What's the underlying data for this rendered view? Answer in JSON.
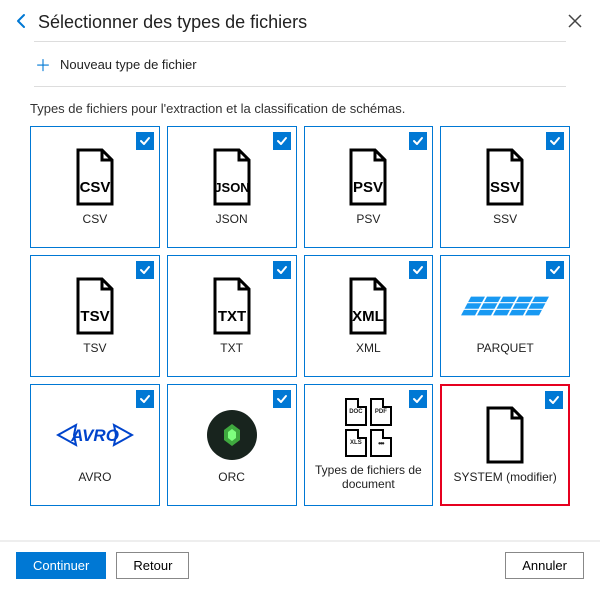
{
  "header": {
    "title": "Sélectionner des types de fichiers"
  },
  "newType": {
    "label": "Nouveau type de fichier"
  },
  "subtitle": "Types de fichiers pour l'extraction et la classification de schémas.",
  "tiles": [
    {
      "label": "CSV",
      "icon": "doc",
      "tag": "CSV",
      "highlight": false
    },
    {
      "label": "JSON",
      "icon": "doc",
      "tag": "JSON",
      "highlight": false
    },
    {
      "label": "PSV",
      "icon": "doc",
      "tag": "PSV",
      "highlight": false
    },
    {
      "label": "SSV",
      "icon": "doc",
      "tag": "SSV",
      "highlight": false
    },
    {
      "label": "TSV",
      "icon": "doc",
      "tag": "TSV",
      "highlight": false
    },
    {
      "label": "TXT",
      "icon": "doc",
      "tag": "TXT",
      "highlight": false
    },
    {
      "label": "XML",
      "icon": "doc",
      "tag": "XML",
      "highlight": false
    },
    {
      "label": "PARQUET",
      "icon": "parquet",
      "tag": "",
      "highlight": false
    },
    {
      "label": "AVRO",
      "icon": "avro",
      "tag": "",
      "highlight": false
    },
    {
      "label": "ORC",
      "icon": "orc",
      "tag": "",
      "highlight": false
    },
    {
      "label": "Types de fichiers de document",
      "icon": "docgrid",
      "tag": "",
      "highlight": false
    },
    {
      "label": "SYSTEM (modifier)",
      "icon": "plain",
      "tag": "",
      "highlight": true
    }
  ],
  "footer": {
    "continue": "Continuer",
    "back": "Retour",
    "cancel": "Annuler"
  }
}
